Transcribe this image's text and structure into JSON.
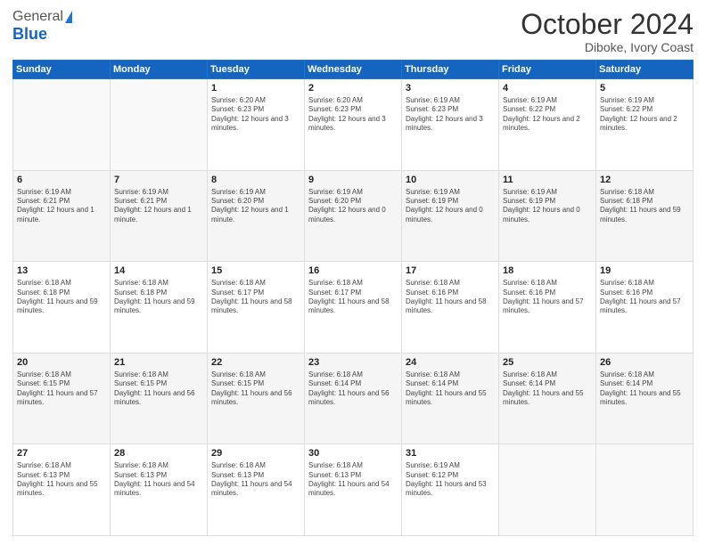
{
  "header": {
    "logo_general": "General",
    "logo_blue": "Blue",
    "month_title": "October 2024",
    "subtitle": "Diboke, Ivory Coast"
  },
  "days_of_week": [
    "Sunday",
    "Monday",
    "Tuesday",
    "Wednesday",
    "Thursday",
    "Friday",
    "Saturday"
  ],
  "weeks": [
    [
      {
        "day": "",
        "info": ""
      },
      {
        "day": "",
        "info": ""
      },
      {
        "day": "1",
        "info": "Sunrise: 6:20 AM\nSunset: 6:23 PM\nDaylight: 12 hours and 3 minutes."
      },
      {
        "day": "2",
        "info": "Sunrise: 6:20 AM\nSunset: 6:23 PM\nDaylight: 12 hours and 3 minutes."
      },
      {
        "day": "3",
        "info": "Sunrise: 6:19 AM\nSunset: 6:23 PM\nDaylight: 12 hours and 3 minutes."
      },
      {
        "day": "4",
        "info": "Sunrise: 6:19 AM\nSunset: 6:22 PM\nDaylight: 12 hours and 2 minutes."
      },
      {
        "day": "5",
        "info": "Sunrise: 6:19 AM\nSunset: 6:22 PM\nDaylight: 12 hours and 2 minutes."
      }
    ],
    [
      {
        "day": "6",
        "info": "Sunrise: 6:19 AM\nSunset: 6:21 PM\nDaylight: 12 hours and 1 minute."
      },
      {
        "day": "7",
        "info": "Sunrise: 6:19 AM\nSunset: 6:21 PM\nDaylight: 12 hours and 1 minute."
      },
      {
        "day": "8",
        "info": "Sunrise: 6:19 AM\nSunset: 6:20 PM\nDaylight: 12 hours and 1 minute."
      },
      {
        "day": "9",
        "info": "Sunrise: 6:19 AM\nSunset: 6:20 PM\nDaylight: 12 hours and 0 minutes."
      },
      {
        "day": "10",
        "info": "Sunrise: 6:19 AM\nSunset: 6:19 PM\nDaylight: 12 hours and 0 minutes."
      },
      {
        "day": "11",
        "info": "Sunrise: 6:19 AM\nSunset: 6:19 PM\nDaylight: 12 hours and 0 minutes."
      },
      {
        "day": "12",
        "info": "Sunrise: 6:18 AM\nSunset: 6:18 PM\nDaylight: 11 hours and 59 minutes."
      }
    ],
    [
      {
        "day": "13",
        "info": "Sunrise: 6:18 AM\nSunset: 6:18 PM\nDaylight: 11 hours and 59 minutes."
      },
      {
        "day": "14",
        "info": "Sunrise: 6:18 AM\nSunset: 6:18 PM\nDaylight: 11 hours and 59 minutes."
      },
      {
        "day": "15",
        "info": "Sunrise: 6:18 AM\nSunset: 6:17 PM\nDaylight: 11 hours and 58 minutes."
      },
      {
        "day": "16",
        "info": "Sunrise: 6:18 AM\nSunset: 6:17 PM\nDaylight: 11 hours and 58 minutes."
      },
      {
        "day": "17",
        "info": "Sunrise: 6:18 AM\nSunset: 6:16 PM\nDaylight: 11 hours and 58 minutes."
      },
      {
        "day": "18",
        "info": "Sunrise: 6:18 AM\nSunset: 6:16 PM\nDaylight: 11 hours and 57 minutes."
      },
      {
        "day": "19",
        "info": "Sunrise: 6:18 AM\nSunset: 6:16 PM\nDaylight: 11 hours and 57 minutes."
      }
    ],
    [
      {
        "day": "20",
        "info": "Sunrise: 6:18 AM\nSunset: 6:15 PM\nDaylight: 11 hours and 57 minutes."
      },
      {
        "day": "21",
        "info": "Sunrise: 6:18 AM\nSunset: 6:15 PM\nDaylight: 11 hours and 56 minutes."
      },
      {
        "day": "22",
        "info": "Sunrise: 6:18 AM\nSunset: 6:15 PM\nDaylight: 11 hours and 56 minutes."
      },
      {
        "day": "23",
        "info": "Sunrise: 6:18 AM\nSunset: 6:14 PM\nDaylight: 11 hours and 56 minutes."
      },
      {
        "day": "24",
        "info": "Sunrise: 6:18 AM\nSunset: 6:14 PM\nDaylight: 11 hours and 55 minutes."
      },
      {
        "day": "25",
        "info": "Sunrise: 6:18 AM\nSunset: 6:14 PM\nDaylight: 11 hours and 55 minutes."
      },
      {
        "day": "26",
        "info": "Sunrise: 6:18 AM\nSunset: 6:14 PM\nDaylight: 11 hours and 55 minutes."
      }
    ],
    [
      {
        "day": "27",
        "info": "Sunrise: 6:18 AM\nSunset: 6:13 PM\nDaylight: 11 hours and 55 minutes."
      },
      {
        "day": "28",
        "info": "Sunrise: 6:18 AM\nSunset: 6:13 PM\nDaylight: 11 hours and 54 minutes."
      },
      {
        "day": "29",
        "info": "Sunrise: 6:18 AM\nSunset: 6:13 PM\nDaylight: 11 hours and 54 minutes."
      },
      {
        "day": "30",
        "info": "Sunrise: 6:18 AM\nSunset: 6:13 PM\nDaylight: 11 hours and 54 minutes."
      },
      {
        "day": "31",
        "info": "Sunrise: 6:19 AM\nSunset: 6:12 PM\nDaylight: 11 hours and 53 minutes."
      },
      {
        "day": "",
        "info": ""
      },
      {
        "day": "",
        "info": ""
      }
    ]
  ]
}
